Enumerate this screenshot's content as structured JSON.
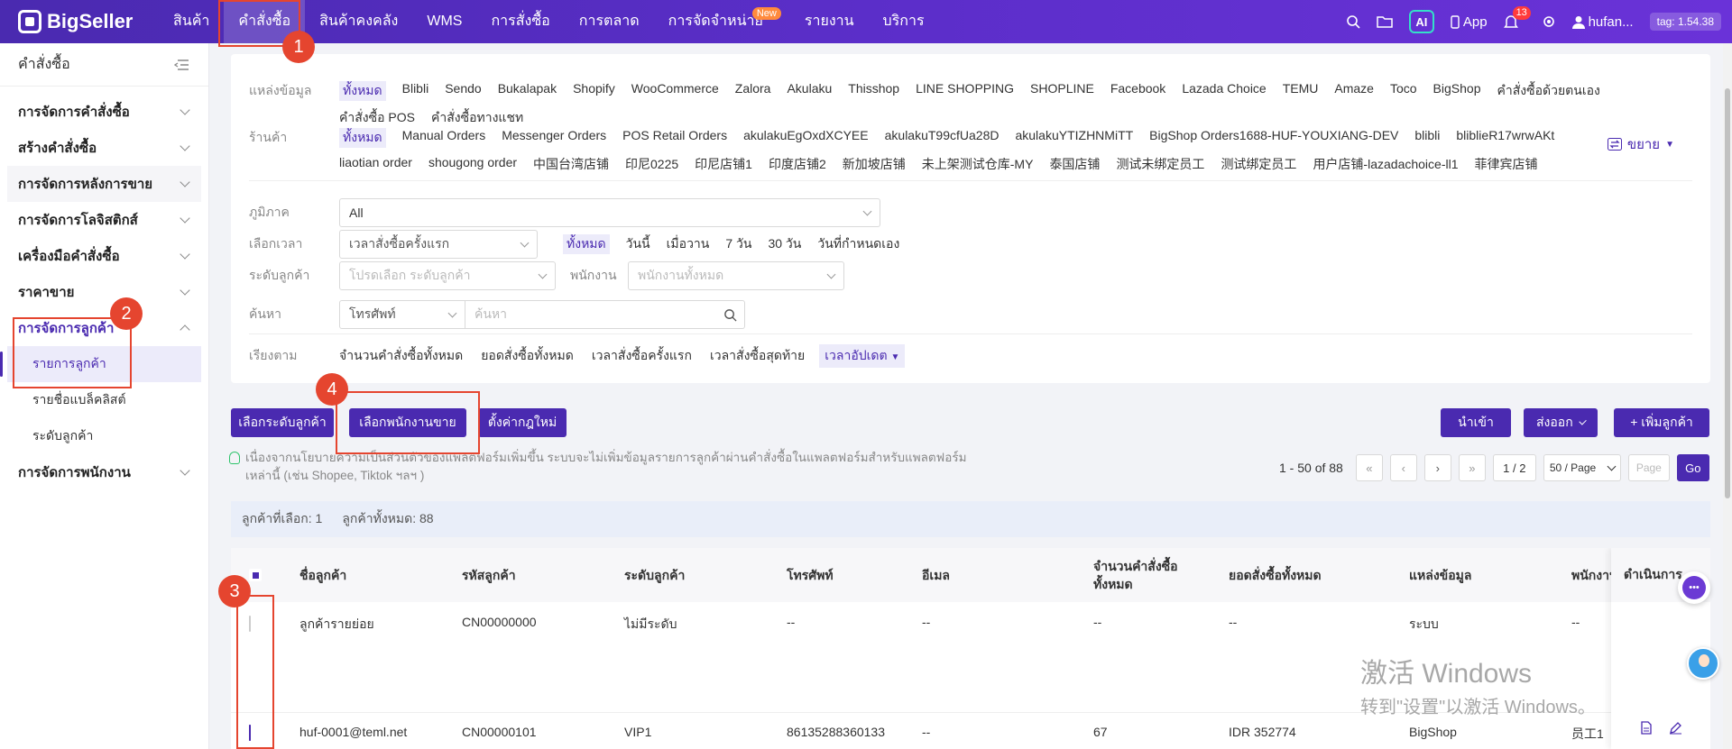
{
  "topbar": {
    "logo": "BigSeller",
    "nav": [
      "สินค้า",
      "คำสั่งซื้อ",
      "สินค้าคงคลัง",
      "WMS",
      "การสั่งซื้อ",
      "การตลาด",
      "การจัดจำหน่าย",
      "รายงาน",
      "บริการ"
    ],
    "new_badge": "New",
    "ai": "AI",
    "app": "App",
    "bell_count": "13",
    "user": "hufan...",
    "tag": "tag: 1.54.38"
  },
  "sidebar": {
    "title": "คำสั่งซื้อ",
    "groups": [
      {
        "label": "การจัดการคำสั่งซื้อ"
      },
      {
        "label": "สร้างคำสั่งซื้อ"
      },
      {
        "label": "การจัดการหลังการขาย"
      },
      {
        "label": "การจัดการโลจิสติกส์"
      },
      {
        "label": "เครื่องมือคำสั่งซื้อ"
      },
      {
        "label": "ราคาขาย"
      },
      {
        "label": "การจัดการลูกค้า"
      },
      {
        "label": "การจัดการพนักงาน"
      }
    ],
    "sub": [
      "รายการลูกค้า",
      "รายชื่อแบล็คลิสต์",
      "ระดับลูกค้า"
    ]
  },
  "filters": {
    "source_label": "แหล่งข้อมูล",
    "sources": [
      "ทั้งหมด",
      "Blibli",
      "Sendo",
      "Bukalapak",
      "Shopify",
      "WooCommerce",
      "Zalora",
      "Akulaku",
      "Thisshop",
      "LINE SHOPPING",
      "SHOPLINE",
      "Facebook",
      "Lazada Choice",
      "TEMU",
      "Amaze",
      "Toco",
      "BigShop",
      "คำสั่งซื้อด้วยตนเอง",
      "คำสั่งซื้อ POS",
      "คำสั่งซื้อทางแชท"
    ],
    "store_label": "ร้านค้า",
    "stores": [
      "ทั้งหมด",
      "Manual Orders",
      "Messenger Orders",
      "POS Retail Orders",
      "akulakuEgOxdXCYEE",
      "akulakuT99cfUa28D",
      "akulakuYTIZHNMiTT",
      "BigShop Orders1688-HUF-YOUXIANG-DEV",
      "blibli",
      "bliblieR17wrwAKt",
      "liaotian order",
      "shougong order",
      "中国台湾店铺",
      "印尼0225",
      "印尼店铺1",
      "印度店铺2",
      "新加坡店铺",
      "未上架测试仓库-MY",
      "泰国店铺",
      "测试未绑定员工",
      "测试绑定员工",
      "用户店铺-lazadachoice-ll1",
      "菲律宾店铺"
    ],
    "expand": "ขยาย",
    "region_label": "ภูมิภาค",
    "region_value": "All",
    "time_label": "เลือกเวลา",
    "time_select": "เวลาสั่งซื้อครั้งแรก",
    "time_opts": [
      "ทั้งหมด",
      "วันนี้",
      "เมื่อวาน",
      "7 วัน",
      "30 วัน",
      "วันที่กำหนดเอง"
    ],
    "level_label": "ระดับลูกค้า",
    "level_placeholder": "โปรดเลือก ระดับลูกค้า",
    "staff_label": "พนักงาน",
    "staff_placeholder": "พนักงานทั้งหมด",
    "search_label": "ค้นหา",
    "search_type": "โทรศัพท์",
    "search_placeholder": "ค้นหา",
    "sort_label": "เรียงตาม",
    "sort_opts": [
      "จำนวนคำสั่งซื้อทั้งหมด",
      "ยอดสั่งซื้อทั้งหมด",
      "เวลาสั่งซื้อครั้งแรก",
      "เวลาสั่งซื้อสุดท้าย"
    ],
    "sort_active": "เวลาอัปเดต"
  },
  "actions": {
    "set_level": "เลือกระดับลูกค้า",
    "set_staff": "เลือกพนักงานขาย",
    "reset": "ตั้งค่ากฎใหม่",
    "import": "นำเข้า",
    "export": "ส่งออก",
    "add": "+ เพิ่มลูกค้า"
  },
  "notice": "เนื่องจากนโยบายความเป็นส่วนตัวของแพลตฟอร์มเพิ่มขึ้น ระบบจะไม่เพิ่มข้อมูลรายการลูกค้าผ่านคำสั่งซื้อในแพลตฟอร์มสำหรับแพลตฟอร์มเหล่านี้ (เช่น Shopee, Tiktok ฯลฯ )",
  "pager": {
    "range": "1 - 50 of 88",
    "page": "1 / 2",
    "page_size": "50 / Page",
    "page_placeholder": "Page",
    "go": "Go"
  },
  "selection": {
    "selected": "ลูกค้าที่เลือก: 1",
    "total": "ลูกค้าทั้งหมด: 88"
  },
  "table": {
    "headers": [
      "ชื่อลูกค้า",
      "รหัสลูกค้า",
      "ระดับลูกค้า",
      "โทรศัพท์",
      "อีเมล",
      "จำนวนคำสั่งซื้อทั้งหมด",
      "ยอดสั่งซื้อทั้งหมด",
      "แหล่งข้อมูล",
      "พนักงาน",
      "ดำเนินการ"
    ],
    "rows": [
      {
        "name": "ลูกค้ารายย่อย",
        "code": "CN00000000",
        "level": "ไม่มีระดับ",
        "phone": "--",
        "email": "--",
        "orders": "--",
        "amount": "--",
        "source": "ระบบ",
        "staff": "--",
        "checked": false
      },
      {
        "name": "huf-0001@teml.net",
        "code": "CN00000101",
        "level": "VIP1",
        "phone": "86135288360133",
        "email": "--",
        "orders": "67",
        "amount": "IDR 352774",
        "source": "BigShop",
        "staff": "员工1",
        "checked": true
      }
    ]
  },
  "annotations": [
    "1",
    "2",
    "3",
    "4"
  ],
  "watermark": {
    "line1": "激活 Windows",
    "line2": "转到\"设置\"以激活 Windows。"
  },
  "colors": {
    "brand": "#4a2ab0",
    "annotation": "#e5452f",
    "new_badge": "#ff8a3d",
    "bell_badge": "#ff3b3b"
  }
}
